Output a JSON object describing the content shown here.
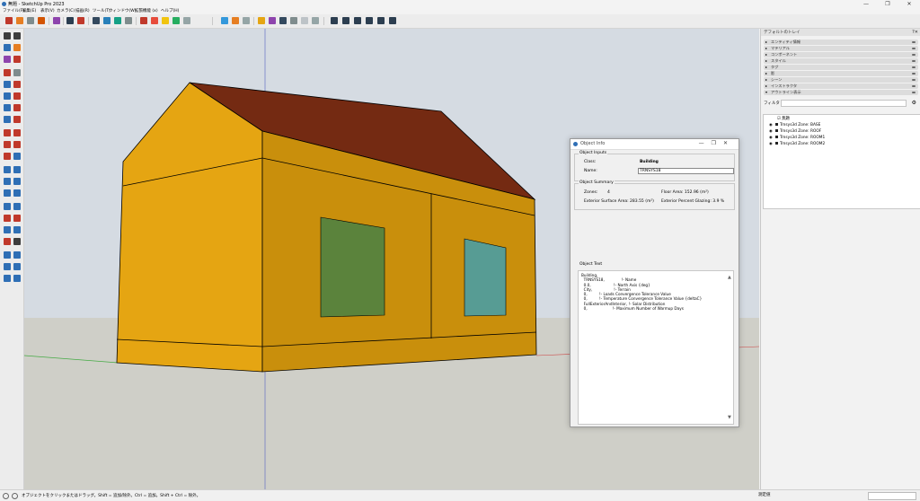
{
  "window": {
    "title": "無題 - SketchUp Pro 2023",
    "minimize": "—",
    "maximize": "❐",
    "close": "✕"
  },
  "menu": [
    "ファイル(F)",
    "編集(E)",
    "表示(V)",
    "カメラ(C)",
    "描画(R)",
    "ツール(T)",
    "ウィンドウ(W)",
    "拡張機能 (x)",
    "ヘルプ(H)"
  ],
  "status": {
    "text": "オブジェクトをクリックまたはドラッグ。Shift = 追加/除外。Ctrl = 追加。Shift + Ctrl = 除外。",
    "measurements_label": "測定値"
  },
  "tray": {
    "title": "デフォルトのトレイ",
    "panels": [
      "エンティティ情報",
      "マテリアル",
      "コンポーネント",
      "スタイル",
      "タグ",
      "影",
      "シーン",
      "インストラクタ",
      "アウトライン表示"
    ],
    "filter_label": "フィルタ",
    "outliner": {
      "root": "無題",
      "items": [
        "Trnsys3d Zone: BASE",
        "Trnsys3d Zone: ROOF",
        "Trnsys3d Zone: ROOM1",
        "Trnsys3d Zone: ROOM2"
      ]
    }
  },
  "dialog": {
    "title": "Object Info",
    "inputs_label": "Object Inputs",
    "class_label": "Class:",
    "class_value": "Building",
    "name_label": "Name:",
    "name_value": "TRNSYS18",
    "summary_label": "Object Summary",
    "zones_label": "Zones:",
    "zones_value": "4",
    "floor_area": "Floor Area:  152.96 (m²)",
    "ext_surface": "Exterior Surface Area:  283.55 (m²)",
    "ext_glazing": "Exterior Percent Glazing:  3.9 %",
    "text_label": "Object Text",
    "object_text": "Building,\n  TRNSYS18,              !- Name\n  0.0,                   !- North Axis {deg}\n  City,                  !- Terrain\n  0,          !- Loads Convergence Tolerance Value\n  0,          !- Temperature Convergence Tolerance Value {deltaC}\n  FullExteriorAndInterior, !- Solar Distribution\n  0,                     !- Maximum Number of Warmup Days"
  },
  "colors": {
    "wall": "#e5a512",
    "wall_dark": "#c98f0c",
    "roof": "#742a12",
    "window_left": "#5b833c",
    "window_right": "#579c94",
    "sky": "#d5dbe2",
    "ground": "#cfcfc8"
  }
}
